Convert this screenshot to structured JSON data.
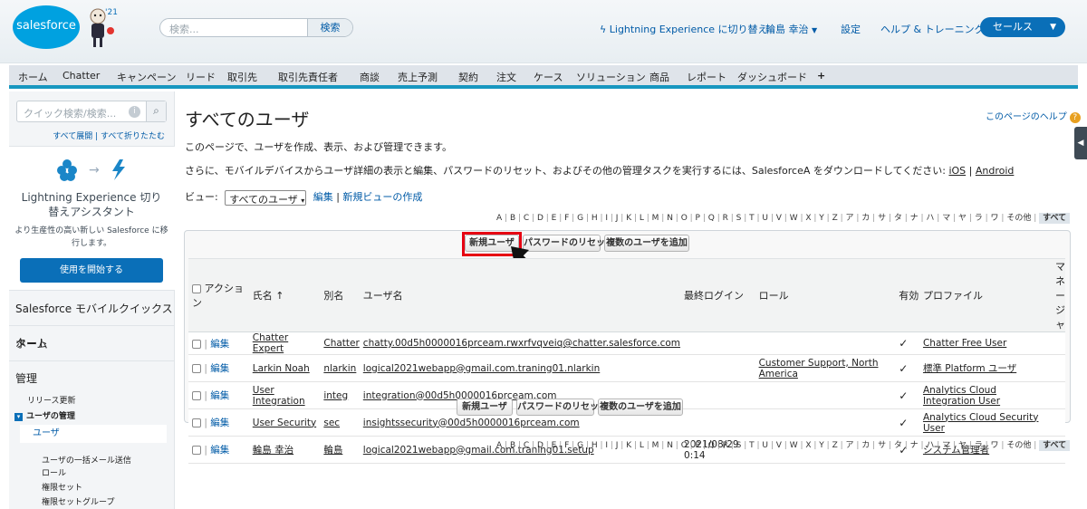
{
  "header": {
    "logo_text": "salesforce",
    "search_placeholder": "検索...",
    "search_button": "検索",
    "lightning_switch": "Lightning Experience に切り替え",
    "user_name": "輪島 幸治",
    "settings": "設定",
    "help_training": "ヘルプ & トレーニング",
    "app_name": "セールス"
  },
  "tabs": [
    "ホーム",
    "Chatter",
    "キャンペーン",
    "リード",
    "取引先",
    "取引先責任者",
    "商談",
    "売上予測",
    "契約",
    "注文",
    "ケース",
    "ソリューション",
    "商品",
    "レポート",
    "ダッシュボード",
    "+"
  ],
  "sidebar": {
    "quick_search_placeholder": "クイック検索/検索...",
    "expand_links": "すべて展開 | すべて折りたたむ",
    "lex_title": "Lightning Experience 切り替えアシスタント",
    "lex_sub": "より生産性の高い新しい Salesforce に移行します。",
    "lex_button": "使用を開始する",
    "sections": [
      "Salesforce モバイルクイックスタート",
      "ホーム",
      "管理"
    ],
    "admin_items": {
      "release": "リリース更新",
      "user_mgmt": "ユーザの管理",
      "users": "ユーザ",
      "mass_mail": "ユーザの一括メール送信",
      "roles": "ロール",
      "permsets": "権限セット",
      "permset_groups": "権限セットグループ"
    }
  },
  "main": {
    "title": "すべてのユーザ",
    "help": "このページのヘルプ",
    "desc1": "このページで、ユーザを作成、表示、および管理できます。",
    "desc2": "さらに、モバイルデバイスからユーザ詳細の表示と編集、パスワードのリセット、およびその他の管理タスクを実行するには、SalesforceA をダウンロードしてください: ",
    "ios": "iOS",
    "android": "Android",
    "view_label": "ビュー:",
    "view_value": "すべてのユーザ",
    "edit_link": "編集",
    "new_view_link": "新規ビューの作成",
    "alphabet": [
      "A",
      "B",
      "C",
      "D",
      "E",
      "F",
      "G",
      "H",
      "I",
      "J",
      "K",
      "L",
      "M",
      "N",
      "O",
      "P",
      "Q",
      "R",
      "S",
      "T",
      "U",
      "V",
      "W",
      "X",
      "Y",
      "Z",
      "ア",
      "カ",
      "サ",
      "タ",
      "ナ",
      "ハ",
      "マ",
      "ヤ",
      "ラ",
      "ワ",
      "その他"
    ],
    "alphabet_all": "すべて",
    "buttons": {
      "new_user": "新規ユーザ",
      "reset_pw": "パスワードのリセット",
      "add_multi": "複数のユーザを追加"
    },
    "columns": [
      "アクション",
      "氏名 ↑",
      "別名",
      "ユーザ名",
      "最終ログイン",
      "ロール",
      "有効",
      "プロファイル",
      "マネージャ"
    ],
    "rows": [
      {
        "action": "編集",
        "name": "Chatter Expert",
        "alias": "Chatter",
        "username": "chatty.00d5h0000016prceam.rwxrfvqveiq@chatter.salesforce.com",
        "last_login": "",
        "role": "",
        "active": "✓",
        "profile": "Chatter Free User"
      },
      {
        "action": "編集",
        "name": "Larkin Noah",
        "alias": "nlarkin",
        "username": "logical2021webapp@gmail.com.traning01.nlarkin",
        "last_login": "",
        "role": "Customer Support, North America",
        "active": "✓",
        "profile": "標準 Platform ユーザ"
      },
      {
        "action": "編集",
        "name": "User Integration",
        "alias": "integ",
        "username": "integration@00d5h0000016prceam.com",
        "last_login": "",
        "role": "",
        "active": "✓",
        "profile": "Analytics Cloud Integration User"
      },
      {
        "action": "編集",
        "name": "User Security",
        "alias": "sec",
        "username": "insightssecurity@00d5h0000016prceam.com",
        "last_login": "",
        "role": "",
        "active": "✓",
        "profile": "Analytics Cloud Security User"
      },
      {
        "action": "編集",
        "name": "輪島 幸治",
        "alias": "輪島",
        "username": "logical2021webapp@gmail.com.traning01.setup",
        "last_login": "2021/08/29 0:14",
        "role": "",
        "active": "✓",
        "profile": "システム管理者"
      }
    ]
  }
}
